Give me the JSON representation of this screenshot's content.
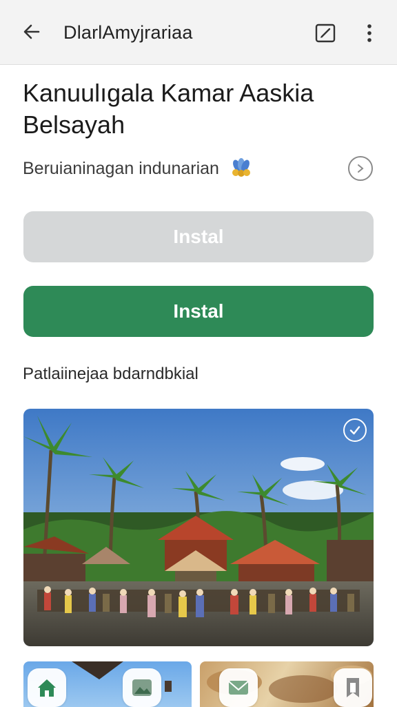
{
  "appbar": {
    "title": "DlarlAmyjrariaa",
    "back_icon": "arrow-left-icon",
    "edit_icon": "edit-icon",
    "more_icon": "more-vertical-icon"
  },
  "heading": "Kanuulıgala Kamar Aaskia Belsayah",
  "subtitle": "Beruianinagan indunarian",
  "subtitle_emoji": "peacock-icon",
  "subtitle_action_icon": "chevron-circle-icon",
  "buttons": {
    "disabled_label": "Instal",
    "primary_label": "Instal"
  },
  "section_label": "Patlaiinejaa bdarndbkial",
  "photo": {
    "description_icon": "village-photo",
    "check_icon": "check-circle-icon"
  },
  "nav": [
    {
      "icon": "home-icon"
    },
    {
      "icon": "gallery-icon"
    },
    {
      "icon": "mail-icon"
    },
    {
      "icon": "bookmark-icon"
    }
  ],
  "colors": {
    "primary": "#2e8a57",
    "disabled": "#d5d7d8",
    "appbar_bg": "#f3f3f3"
  }
}
